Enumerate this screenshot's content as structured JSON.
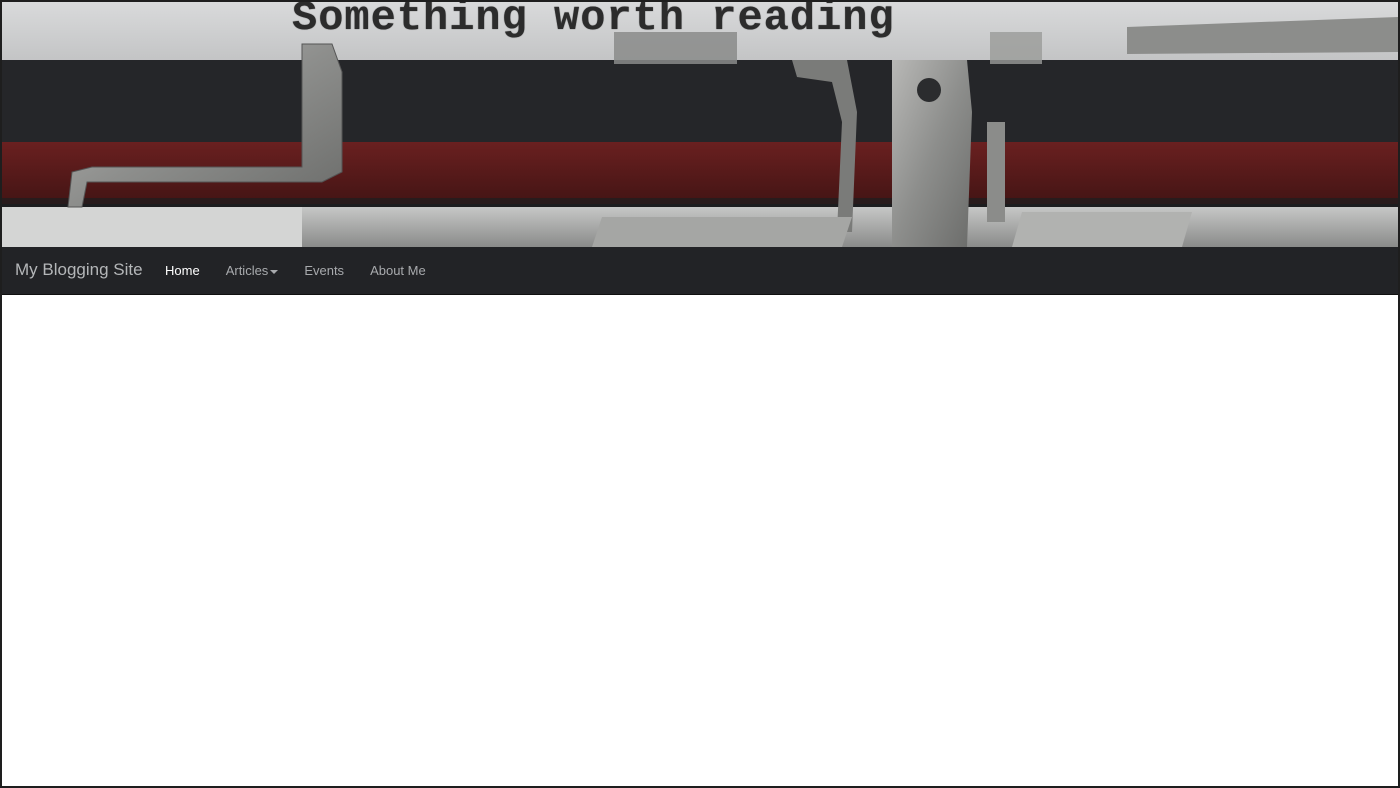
{
  "banner": {
    "text": "Something worth reading",
    "image": "typewriter-ribbon-photo"
  },
  "navbar": {
    "brand": "My Blogging Site",
    "items": [
      {
        "label": "Home",
        "active": true
      },
      {
        "label": "Articles",
        "dropdown": true
      },
      {
        "label": "Events"
      },
      {
        "label": "About Me"
      }
    ]
  },
  "colors": {
    "navbar_bg": "#222326",
    "nav_link": "#a8aaad",
    "nav_active": "#ffffff",
    "ribbon_red": "#5a1c1c",
    "ribbon_black": "#242528"
  }
}
